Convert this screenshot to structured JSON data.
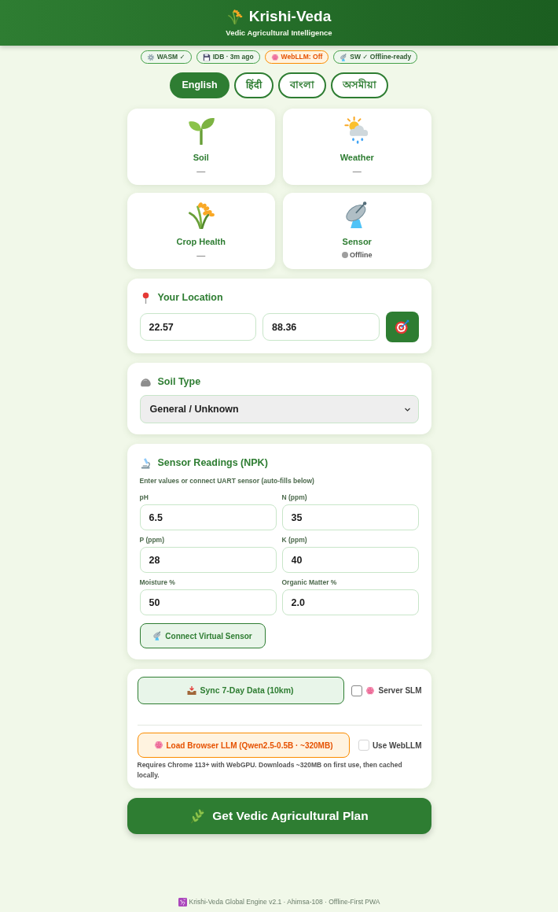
{
  "header": {
    "title": "Krishi-Veda",
    "subtitle": "Vedic Agricultural Intelligence"
  },
  "status_chips": [
    {
      "label": "WASM ✓",
      "on": true
    },
    {
      "label": "IDB · 3m ago",
      "on": true
    },
    {
      "label": "WebLLM: Off",
      "on": false
    },
    {
      "label": "SW ✓ Offline-ready",
      "on": true
    }
  ],
  "languages": [
    {
      "label": "English",
      "selected": true
    },
    {
      "label": "हिंदी",
      "selected": false
    },
    {
      "label": "বাংলা",
      "selected": false
    },
    {
      "label": "অসমীয়া",
      "selected": false
    }
  ],
  "summary_cards": [
    {
      "kind": "value",
      "label": "Soil",
      "value": "—"
    },
    {
      "kind": "value",
      "label": "Weather",
      "value": "—"
    },
    {
      "kind": "value",
      "label": "Crop Health",
      "value": "—"
    },
    {
      "kind": "status",
      "label": "Sensor",
      "value": "Offline",
      "online": false
    }
  ],
  "location": {
    "title": "Your Location",
    "latitude": "22.57",
    "longitude": "88.36"
  },
  "soil_type": {
    "title": "Soil Type",
    "value": "General / Unknown"
  },
  "sensor_readings": {
    "title": "Sensor Readings (NPK)",
    "hint": "Enter values or connect UART sensor (auto-fills below)",
    "fields": [
      {
        "label": "pH",
        "value": "6.5"
      },
      {
        "label": "N (ppm)",
        "value": "35"
      },
      {
        "label": "P (ppm)",
        "value": "28"
      },
      {
        "label": "K (ppm)",
        "value": "40"
      },
      {
        "label": "Moisture %",
        "value": "50"
      },
      {
        "label": "Organic Matter %",
        "value": "2.0"
      }
    ],
    "button": "Connect Virtual Sensor"
  },
  "data_sources": {
    "sync_button": "Sync 7-Day Data (10km)",
    "server_slm": {
      "label": "Server SLM",
      "checked": false,
      "disabled": false
    },
    "llm_button": "Load Browser LLM (Qwen2.5-0.5B · ~320MB)",
    "use_webllm": {
      "label": "Use WebLLM",
      "checked": false,
      "disabled": true
    },
    "note": "Requires Chrome 113+ with WebGPU. Downloads ~320MB on first use, then cached locally."
  },
  "primary_button": "Get Vedic Agricultural Plan",
  "footer": "Krishi-Veda Global Engine v2.1 · Ahimsa-108 · Offline-First PWA"
}
